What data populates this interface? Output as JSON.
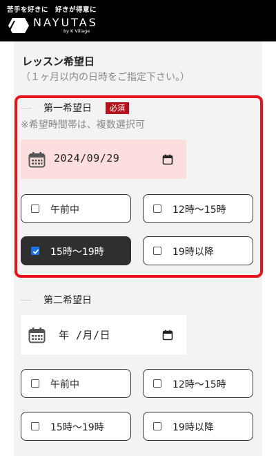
{
  "header": {
    "tagline": "苦手を好きに　好きが得意に",
    "logo_text": "NAYUTAS",
    "logo_sub": "by K Village"
  },
  "section": {
    "title": "レッスン希望日",
    "note": "（１ヶ月以内の日時をご指定下さい。）"
  },
  "first": {
    "label": "第一希望日",
    "required_badge": "必須",
    "hint": "※希望時間帯は、複数選択可",
    "date_value": "2024/09/29",
    "options": [
      {
        "label": "午前中",
        "checked": false
      },
      {
        "label": "12時〜15時",
        "checked": false
      },
      {
        "label": "15時〜19時",
        "checked": true
      },
      {
        "label": "19時以降",
        "checked": false
      }
    ]
  },
  "second": {
    "label": "第二希望日",
    "date_value": "年 /月/日",
    "options": [
      {
        "label": "午前中",
        "checked": false
      },
      {
        "label": "12時〜15時",
        "checked": false
      },
      {
        "label": "15時〜19時",
        "checked": false
      },
      {
        "label": "19時以降",
        "checked": false
      }
    ]
  },
  "colors": {
    "header_bg": "#000000",
    "highlight_border": "#e8141c",
    "badge_bg": "#b3121c",
    "filled_date_bg": "#fddede",
    "checked_option_bg": "#2f2f2f",
    "checkbox_accent": "#1a73e8"
  },
  "icons": [
    "calendar-icon",
    "date-picker-icon",
    "checkmark-icon",
    "hexagon-logo-icon"
  ]
}
